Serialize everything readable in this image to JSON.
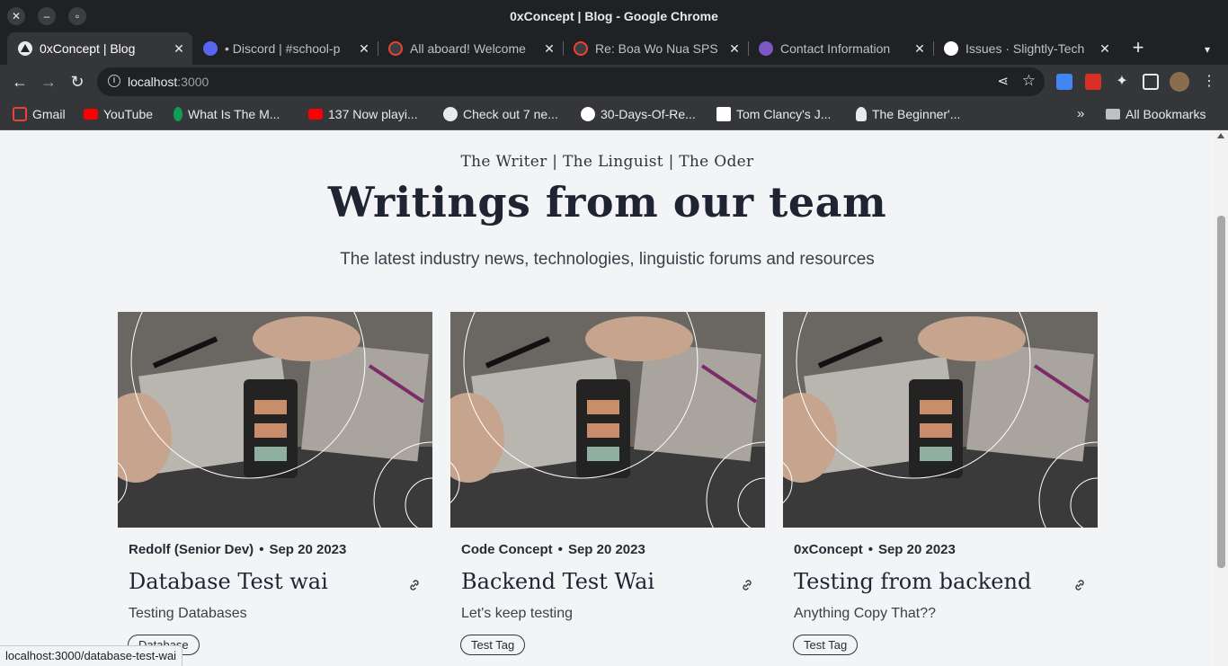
{
  "window": {
    "title": "0xConcept | Blog - Google Chrome"
  },
  "tabs": [
    {
      "label": "0xConcept | Blog",
      "active": true,
      "icon": "triangle-logo-icon",
      "color": "#e8eaed"
    },
    {
      "label": "• Discord | #school-p",
      "active": false,
      "icon": "discord-icon",
      "color": "#5865f2"
    },
    {
      "label": "All aboard! Welcome",
      "active": false,
      "icon": "gmail-icon",
      "color": "#ea4335"
    },
    {
      "label": "Re: Boa Wo Nua SPS",
      "active": false,
      "icon": "gmail-icon",
      "color": "#ea4335"
    },
    {
      "label": "Contact Information",
      "active": false,
      "icon": "form-icon",
      "color": "#7e57c2"
    },
    {
      "label": "Issues · Slightly-Tech",
      "active": false,
      "icon": "github-icon",
      "color": "#ffffff"
    }
  ],
  "toolbar": {
    "url_host": "localhost",
    "url_port": ":3000"
  },
  "bookmarks": {
    "items": [
      {
        "label": "Gmail",
        "icon": "gmail-icon",
        "color": "#ea4335"
      },
      {
        "label": "YouTube",
        "icon": "youtube-icon",
        "color": "#ff0000"
      },
      {
        "label": "What Is The M...",
        "icon": "leaf-icon",
        "color": "#0f9d58"
      },
      {
        "label": "137 Now playi...",
        "icon": "youtube-icon",
        "color": "#ff0000"
      },
      {
        "label": "Check out 7 ne...",
        "icon": "globe-icon",
        "color": "#e8eaed"
      },
      {
        "label": "30-Days-Of-Re...",
        "icon": "github-icon",
        "color": "#ffffff"
      },
      {
        "label": "Tom Clancy's J...",
        "icon": "k-logo-icon",
        "color": "#ffffff"
      },
      {
        "label": "The Beginner'...",
        "icon": "person-icon",
        "color": "#e8eaed"
      }
    ],
    "more": "»",
    "all_label": "All Bookmarks"
  },
  "hero": {
    "tagline": "The Writer | The Linguist | The Oder",
    "title": "Writings from our team",
    "subtitle": "The latest industry news, technologies, linguistic forums and resources"
  },
  "posts": [
    {
      "author": "Redolf (Senior Dev)",
      "date": "Sep 20 2023",
      "title": "Database Test wai",
      "description": "Testing Databases",
      "tag": "Database"
    },
    {
      "author": "Code Concept",
      "date": "Sep 20 2023",
      "title": "Backend Test Wai",
      "description": "Let's keep testing",
      "tag": "Test Tag"
    },
    {
      "author": "0xConcept",
      "date": "Sep 20 2023",
      "title": "Testing from backend",
      "description": "Anything Copy That??",
      "tag": "Test Tag"
    }
  ],
  "status_url": "localhost:3000/database-test-wai"
}
